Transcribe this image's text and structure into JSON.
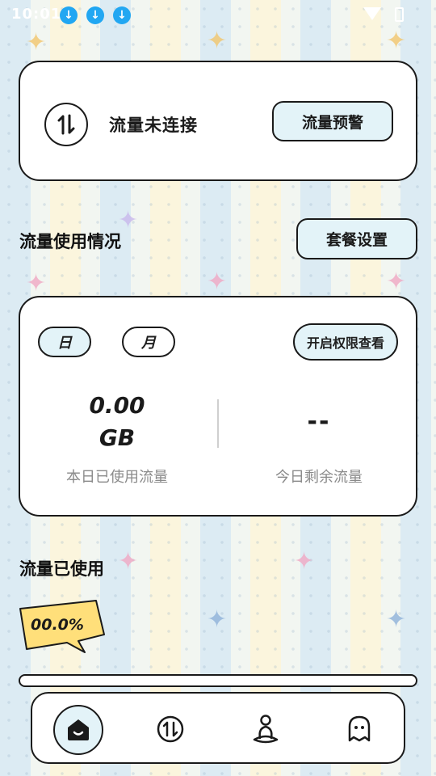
{
  "status_bar": {
    "time": "10:01",
    "icons": [
      "download-icon",
      "download-icon",
      "download-icon",
      "wifi-icon",
      "battery-icon"
    ]
  },
  "connection": {
    "icon": "up-down-arrows-icon",
    "status": "流量未连接",
    "alert_button": "流量预警"
  },
  "usage": {
    "title": "流量使用情况",
    "plan_button": "套餐设置",
    "tabs": [
      "日",
      "月"
    ],
    "permission_button": "开启权限查看",
    "used_value": "0.00",
    "used_unit": "GB",
    "used_label": "本日已使用流量",
    "remaining_value": "--",
    "remaining_label": "今日剩余流量"
  },
  "used_section": {
    "title": "流量已使用",
    "percent_text": "00.0%",
    "percent_value": 0
  },
  "bottom_nav": [
    "home-icon",
    "traffic-icon",
    "meditation-icon",
    "ghost-icon"
  ],
  "colors": {
    "accent": "#e3f3f8",
    "border": "#1a1a1a",
    "bubble": "#ffdf7a",
    "download_badge": "#22a7f2",
    "muted_text": "#8a8a8a"
  }
}
